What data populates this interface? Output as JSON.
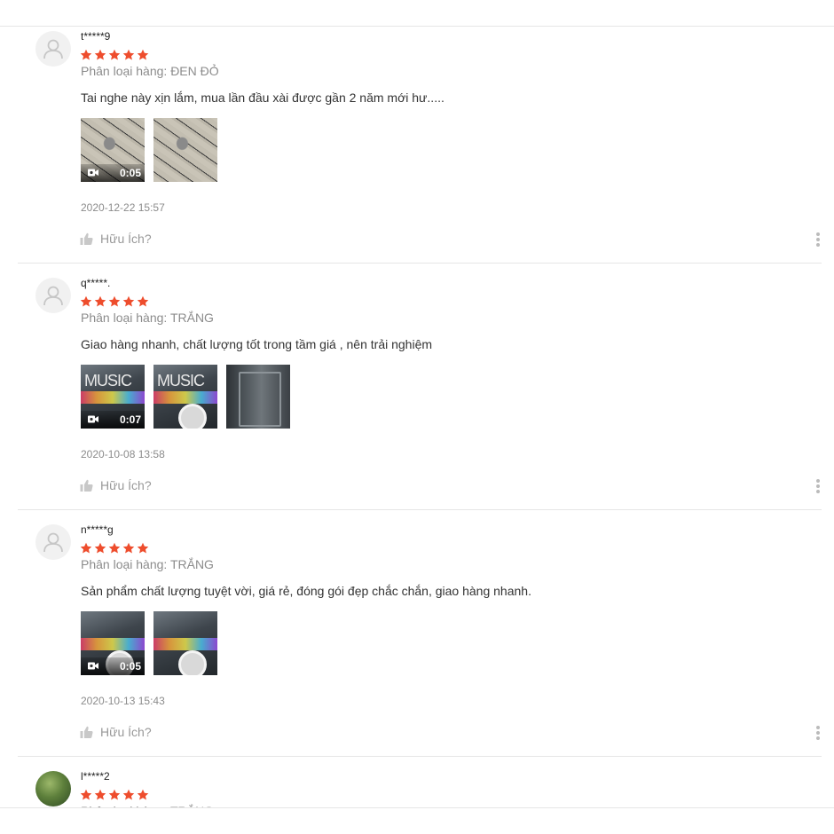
{
  "colors": {
    "star": "#ee4d2d",
    "muted": "#8c8c8c",
    "border": "#e6e6e6"
  },
  "reviews": [
    {
      "username": "t*****9",
      "rating": 5,
      "avatar": "default-user-icon",
      "variant": "Phân loại hàng: ĐEN ĐỎ",
      "content": "Tai nghe này xịn lắm,  mua lần đầu xài được gần 2 năm mới hư.....",
      "media": [
        {
          "type": "video",
          "duration": "0:05"
        },
        {
          "type": "image"
        }
      ],
      "date": "2020-12-22 15:57",
      "helpful_label": "Hữu Ích?"
    },
    {
      "username": "q*****.",
      "rating": 5,
      "avatar": "default-user-icon",
      "variant": "Phân loại hàng: TRẮNG",
      "content": "Giao hàng nhanh, chất lượng tốt trong tầm giá , nên trải nghiệm",
      "media": [
        {
          "type": "video",
          "duration": "0:07"
        },
        {
          "type": "image"
        },
        {
          "type": "image"
        }
      ],
      "date": "2020-10-08 13:58",
      "helpful_label": "Hữu Ích?"
    },
    {
      "username": "n*****g",
      "rating": 5,
      "avatar": "default-user-icon",
      "variant": "Phân loại hàng: TRẮNG",
      "content": "Sản phẩm chất lượng tuyệt vời, giá rẻ, đóng gói đẹp chắc chắn, giao hàng nhanh.",
      "media": [
        {
          "type": "video",
          "duration": "0:05"
        },
        {
          "type": "image"
        }
      ],
      "date": "2020-10-13 15:43",
      "helpful_label": "Hữu Ích?"
    },
    {
      "username": "l*****2",
      "rating": 5,
      "avatar": "user-photo",
      "variant": "Phân loại hàng: TRẮNG"
    }
  ]
}
